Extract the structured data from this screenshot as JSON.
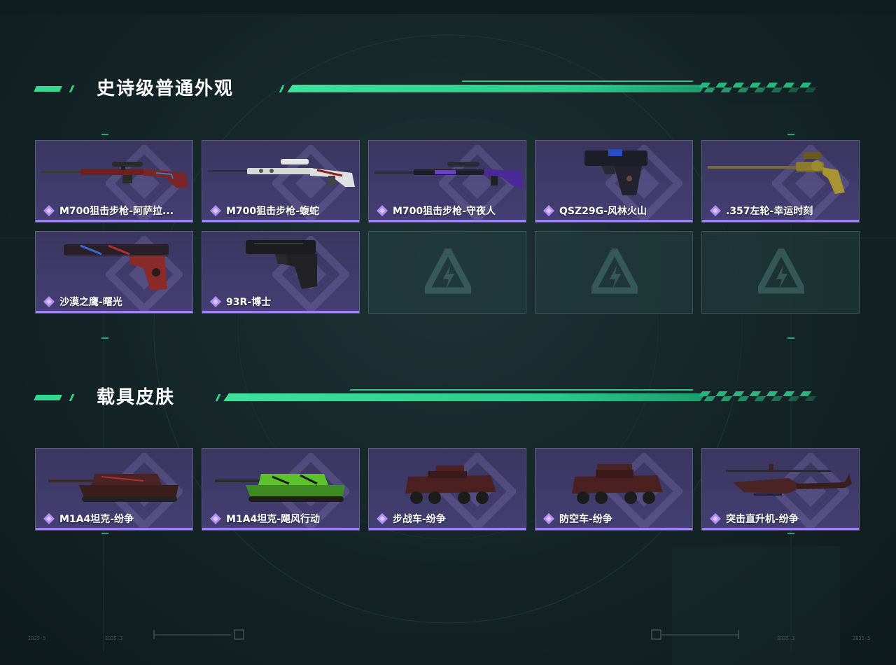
{
  "sections": [
    {
      "title": "史诗级普通外观",
      "items": [
        {
          "name": "M700狙击步枪-阿萨拉...",
          "icon": "sniper-rifle-icon"
        },
        {
          "name": "M700狙击步枪-蝮蛇",
          "icon": "sniper-rifle-icon"
        },
        {
          "name": "M700狙击步枪-守夜人",
          "icon": "sniper-rifle-icon"
        },
        {
          "name": "QSZ29G-风林火山",
          "icon": "pistol-icon"
        },
        {
          "name": ".357左轮-幸运时刻",
          "icon": "revolver-icon"
        },
        {
          "name": "沙漠之鹰-曙光",
          "icon": "pistol-icon"
        },
        {
          "name": "93R-博士",
          "icon": "pistol-icon"
        }
      ],
      "empty_slots": 3
    },
    {
      "title": "载具皮肤",
      "items": [
        {
          "name": "M1A4坦克-纷争",
          "icon": "tank-icon"
        },
        {
          "name": "M1A4坦克-飓风行动",
          "icon": "tank-icon"
        },
        {
          "name": "步战车-纷争",
          "icon": "ifv-icon"
        },
        {
          "name": "防空车-纷争",
          "icon": "aa-vehicle-icon"
        },
        {
          "name": "突击直升机-纷争",
          "icon": "helicopter-icon"
        }
      ]
    }
  ],
  "footer": {
    "left_a": "2035-5",
    "left_b": "2035-3",
    "right_a": "2035-3",
    "right_b": "2035-5"
  },
  "colors": {
    "accent": "#33d891",
    "rarity": "#a47ef5",
    "card_bg": "#3f3a6a"
  }
}
